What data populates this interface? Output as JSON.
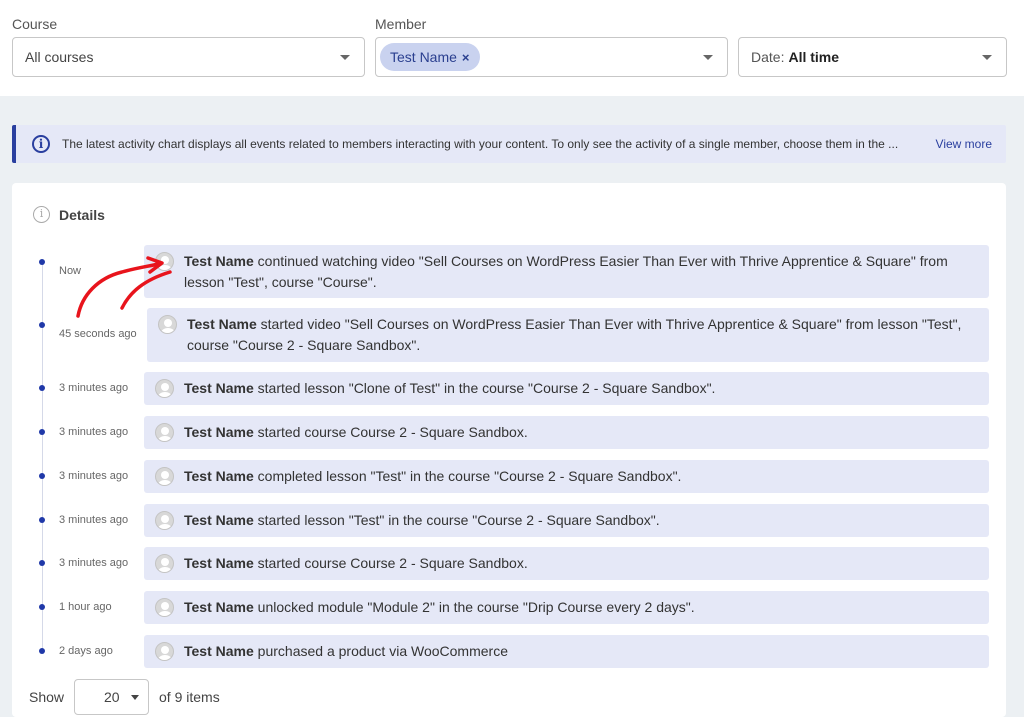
{
  "filters": {
    "course_label": "Course",
    "course_value": "All courses",
    "member_label": "Member",
    "member_chip": "Test Name",
    "member_chip_remove": "×",
    "date_prefix": "Date:",
    "date_value": "All time"
  },
  "info": {
    "text": "The latest activity chart displays all events related to members interacting with your content. To only see the activity of a single member, choose them in the ...",
    "link": "View more",
    "icon": "i"
  },
  "details": {
    "icon": "i",
    "title": "Details"
  },
  "activities": [
    {
      "time": "Now",
      "name": "Test Name",
      "text": "continued watching video \"Sell Courses on WordPress Easier Than Ever with Thrive Apprentice & Square\" from lesson \"Test\", course \"Course\"."
    },
    {
      "time": "45 seconds ago",
      "name": "Test Name",
      "text": "started video \"Sell Courses on WordPress Easier Than Ever with Thrive Apprentice & Square\" from lesson \"Test\", course \"Course 2 - Square Sandbox\"."
    },
    {
      "time": "3 minutes ago",
      "name": "Test Name",
      "text": "started lesson \"Clone of Test\" in the course \"Course 2 - Square Sandbox\"."
    },
    {
      "time": "3 minutes ago",
      "name": "Test Name",
      "text": "started course Course 2 - Square Sandbox."
    },
    {
      "time": "3 minutes ago",
      "name": "Test Name",
      "text": "completed lesson \"Test\" in the course \"Course 2 - Square Sandbox\"."
    },
    {
      "time": "3 minutes ago",
      "name": "Test Name",
      "text": "started lesson \"Test\" in the course \"Course 2 - Square Sandbox\"."
    },
    {
      "time": "3 minutes ago",
      "name": "Test Name",
      "text": "started course Course 2 - Square Sandbox."
    },
    {
      "time": "1 hour ago",
      "name": "Test Name",
      "text": "unlocked module \"Module 2\" in the course \"Drip Course every 2 days\"."
    },
    {
      "time": "2 days ago",
      "name": "Test Name",
      "text": "purchased a product via WooCommerce"
    }
  ],
  "pagination": {
    "show_label": "Show",
    "page_size": "20",
    "items_label": "of 9 items"
  },
  "colors": {
    "accent": "#2a3f9f",
    "card_bg": "#e5e8f7",
    "annotation": "#e8141c"
  }
}
